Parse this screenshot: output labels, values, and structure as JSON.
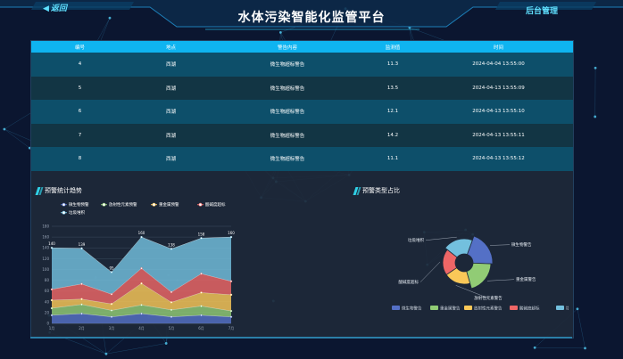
{
  "header": {
    "back_label": "返回",
    "title": "水体污染智能化监管平台",
    "admin_label": "后台管理"
  },
  "table": {
    "columns": [
      "编号",
      "地点",
      "警告内容",
      "监测值",
      "时间"
    ],
    "rows": [
      [
        "4",
        "西湖",
        "微生物超标警告",
        "11.3",
        "2024-04-04 13:55:00"
      ],
      [
        "5",
        "西湖",
        "微生物超标警告",
        "13.5",
        "2024-04-13 13:55:09"
      ],
      [
        "6",
        "西湖",
        "微生物超标警告",
        "12.1",
        "2024-04-13 13:55:10"
      ],
      [
        "7",
        "西湖",
        "微生物超标警告",
        "14.2",
        "2024-04-13 13:55:11"
      ],
      [
        "8",
        "西湖",
        "微生物超标警告",
        "11.1",
        "2024-04-13 13:55:12"
      ]
    ]
  },
  "trend": {
    "title": "预警统计趋势"
  },
  "pie": {
    "title": "预警类型占比"
  },
  "colors": {
    "accent": "#0fb4f0",
    "series": [
      "#5470c6",
      "#91cc75",
      "#fac858",
      "#ee6666",
      "#73c0de"
    ]
  },
  "chart_data": [
    {
      "type": "area",
      "stacked": true,
      "categories": [
        "1月",
        "2月",
        "3月",
        "4月",
        "5月",
        "6月",
        "7月"
      ],
      "ylim": [
        0,
        180
      ],
      "yticks": [
        0,
        20,
        40,
        60,
        80,
        100,
        120,
        140,
        160,
        180
      ],
      "series": [
        {
          "name": "微生物预警",
          "values": [
            15,
            18,
            12,
            18,
            12,
            15,
            12
          ]
        },
        {
          "name": "放射性元素预警",
          "values": [
            13,
            17,
            12,
            16,
            13,
            17,
            11
          ]
        },
        {
          "name": "重金属预警",
          "values": [
            15,
            10,
            12,
            40,
            14,
            25,
            30
          ]
        },
        {
          "name": "酸碱度超标",
          "values": [
            20,
            28,
            18,
            28,
            19,
            35,
            25
          ]
        },
        {
          "name": "垃圾堆积",
          "values": [
            77,
            66,
            41,
            58,
            80,
            66,
            82
          ]
        }
      ],
      "totals": [
        140,
        139,
        95,
        160,
        138,
        158,
        160
      ],
      "point_labels": [
        "140",
        "139",
        "95",
        "160",
        "138",
        "158",
        "160"
      ],
      "legend": "top"
    },
    {
      "type": "pie",
      "rose": true,
      "slices": [
        {
          "name": "微生物警告",
          "value": 1,
          "color": "#5470c6"
        },
        {
          "name": "重金属警告",
          "value": 1,
          "color": "#91cc75"
        },
        {
          "name": "放射性元素警告",
          "value": 1,
          "color": "#fac858"
        },
        {
          "name": "酸碱度超标",
          "value": 1,
          "color": "#ee6666"
        },
        {
          "name": "垃圾堆积",
          "value": 1,
          "color": "#73c0de"
        }
      ],
      "legend": "bottom"
    }
  ]
}
